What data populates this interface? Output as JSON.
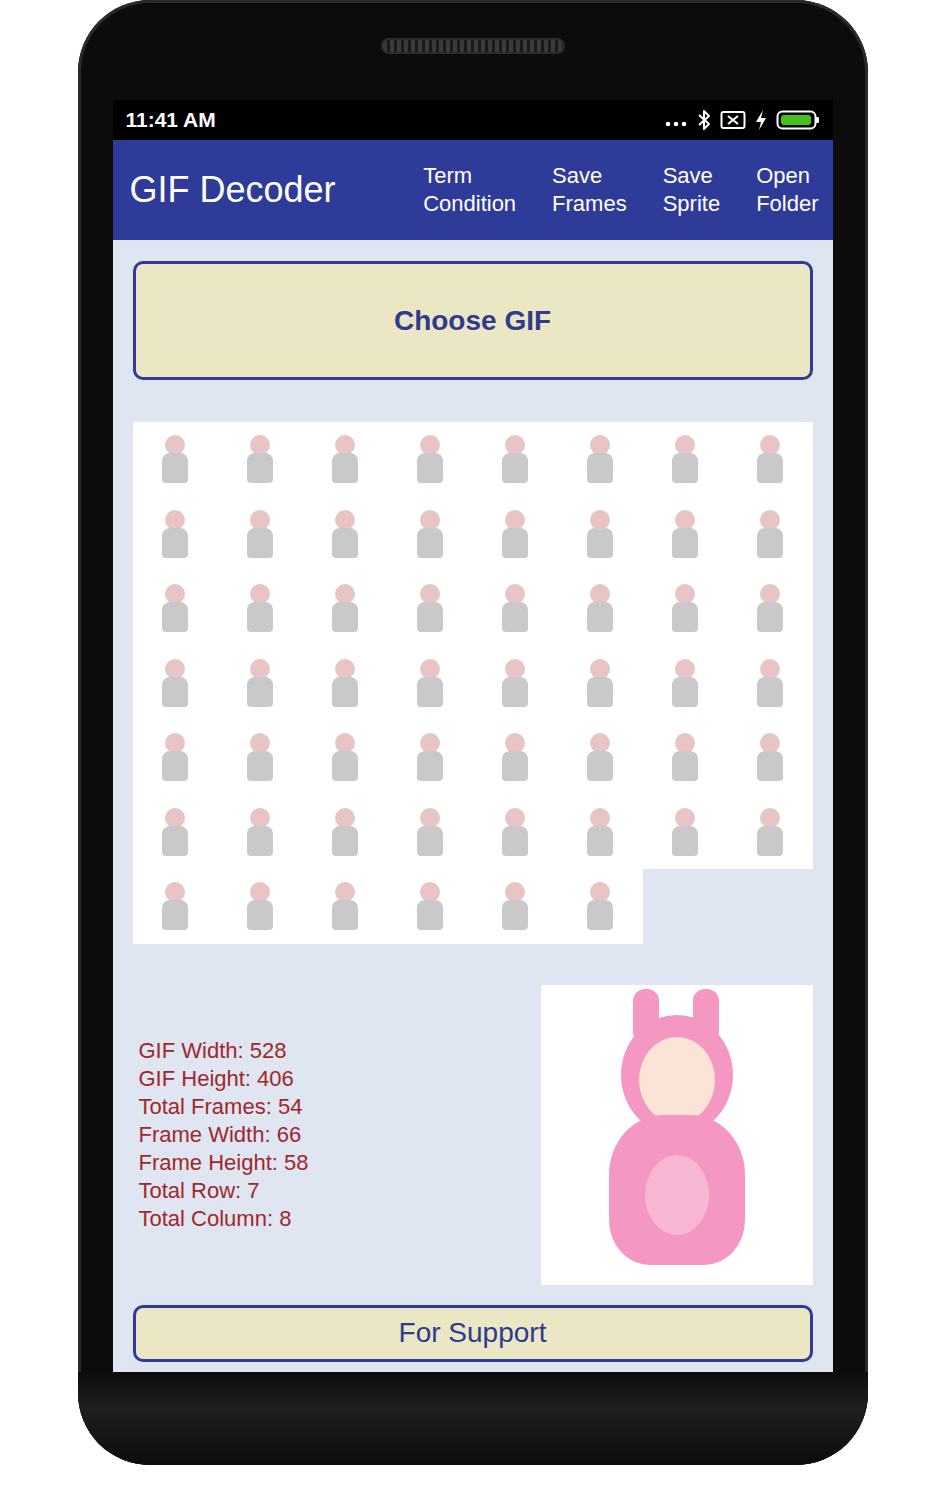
{
  "status_bar": {
    "time": "11:41 AM",
    "battery": {
      "level": 1.0,
      "charging": true
    }
  },
  "app_bar": {
    "title": "GIF Decoder",
    "menu": [
      "Term Condition",
      "Save Frames",
      "Save Sprite",
      "Open Folder"
    ]
  },
  "choose_button": "Choose GIF",
  "info": [
    {
      "label": "GIF Width:",
      "value": "528"
    },
    {
      "label": "GIF Height:",
      "value": "406"
    },
    {
      "label": "Total Frames:",
      "value": "54"
    },
    {
      "label": "Frame Width:",
      "value": "66"
    },
    {
      "label": "Frame Height:",
      "value": "58"
    },
    {
      "label": "Total Row:",
      "value": "7"
    },
    {
      "label": "Total Column:",
      "value": "8"
    }
  ],
  "support_button": "For Support"
}
